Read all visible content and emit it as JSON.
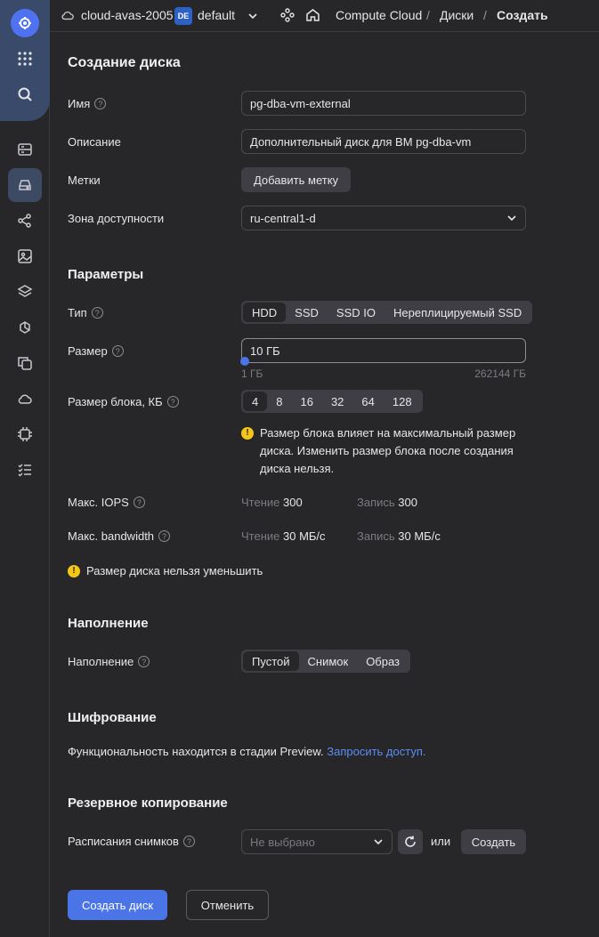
{
  "header": {
    "cloud_name": "cloud-avas-2005",
    "folder_badge": "DE",
    "folder_name": "default",
    "breadcrumbs": [
      "Compute Cloud",
      "Диски",
      "Создать"
    ]
  },
  "sidebar": {
    "icons": [
      "logo-icon",
      "apps-icon",
      "search-icon",
      "server-icon",
      "disk-icon",
      "network-icon",
      "image-icon",
      "layers-icon",
      "snapshot-icon",
      "copy-icon",
      "cloud-icon",
      "chip-icon",
      "checklist-icon"
    ],
    "active": "disk-icon"
  },
  "form": {
    "title": "Создание диска",
    "name_label": "Имя",
    "name_value": "pg-dba-vm-external",
    "description_label": "Описание",
    "description_value": "Дополнительный диск для ВМ pg-dba-vm",
    "labels_label": "Метки",
    "add_label_button": "Добавить метку",
    "zone_label": "Зона доступности",
    "zone_value": "ru-central1-d"
  },
  "params": {
    "title": "Параметры",
    "type_label": "Тип",
    "types": [
      "HDD",
      "SSD",
      "SSD IO",
      "Нереплицируемый SSD"
    ],
    "type_selected": "HDD",
    "size_label": "Размер",
    "size_value": "10 ГБ",
    "size_min": "1 ГБ",
    "size_max": "262144 ГБ",
    "size_slider_fraction": 0.0,
    "block_label": "Размер блока, КБ",
    "blocks": [
      "4",
      "8",
      "16",
      "32",
      "64",
      "128"
    ],
    "block_selected": "4",
    "block_warning": "Размер блока влияет на максимальный размер диска. Изменить размер блока после создания диска нельзя.",
    "iops_label": "Макс. IOPS",
    "read_label": "Чтение",
    "write_label": "Запись",
    "iops_read": "300",
    "iops_write": "300",
    "bandwidth_label": "Макс. bandwidth",
    "bw_read": "30 МБ/с",
    "bw_write": "30 МБ/с",
    "size_warning": "Размер диска нельзя уменьшить"
  },
  "fill": {
    "title": "Наполнение",
    "label": "Наполнение",
    "options": [
      "Пустой",
      "Снимок",
      "Образ"
    ],
    "selected": "Пустой"
  },
  "encryption": {
    "title": "Шифрование",
    "text": "Функциональность находится в стадии Preview.",
    "link": "Запросить доступ."
  },
  "backup": {
    "title": "Резервное копирование",
    "schedule_label": "Расписания снимков",
    "schedule_placeholder": "Не выбрано",
    "or_text": "или",
    "create_button": "Создать"
  },
  "actions": {
    "submit": "Создать диск",
    "cancel": "Отменить"
  },
  "colors": {
    "accent": "#4b74e6",
    "link": "#5b8df5",
    "warning": "#f5c518"
  }
}
